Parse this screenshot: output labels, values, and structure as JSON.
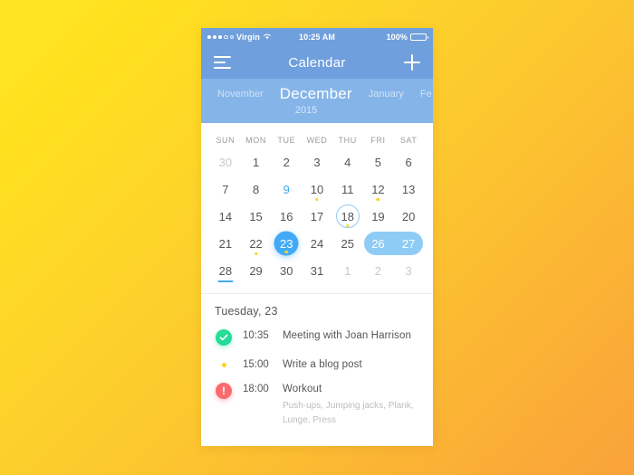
{
  "background": {
    "gradient_from": "#ffe425",
    "gradient_to": "#f9a23a"
  },
  "status_bar": {
    "carrier": "Virgin",
    "signal_filled": 3,
    "signal_empty": 2,
    "wifi_icon": "wifi-icon",
    "time": "10:25 AM",
    "battery_percent": "100%",
    "battery_icon": "battery-icon"
  },
  "nav_bar": {
    "menu_icon": "hamburger-icon",
    "title": "Calendar",
    "add_icon": "plus-icon",
    "background": "#6f9fdc"
  },
  "month_strip": {
    "background": "#84b4e8",
    "months": [
      {
        "label": "November",
        "active": false
      },
      {
        "label": "December",
        "active": true
      },
      {
        "label": "January",
        "active": false
      },
      {
        "label": "Fe",
        "active": false
      }
    ],
    "year": "2015"
  },
  "calendar": {
    "weekdays": [
      "SUN",
      "MON",
      "TUE",
      "WED",
      "THU",
      "FRI",
      "SAT"
    ],
    "accent_blue": "#42aaf5",
    "dot_yellow": "#ffd21f",
    "weeks": [
      [
        {
          "n": "30",
          "muted": true
        },
        {
          "n": "1"
        },
        {
          "n": "2"
        },
        {
          "n": "3"
        },
        {
          "n": "4"
        },
        {
          "n": "5"
        },
        {
          "n": "6"
        }
      ],
      [
        {
          "n": "7"
        },
        {
          "n": "8"
        },
        {
          "n": "9",
          "accent_text": true
        },
        {
          "n": "10",
          "dot": true
        },
        {
          "n": "11"
        },
        {
          "n": "12",
          "dot": true
        },
        {
          "n": "13"
        }
      ],
      [
        {
          "n": "14"
        },
        {
          "n": "15"
        },
        {
          "n": "16"
        },
        {
          "n": "17"
        },
        {
          "n": "18",
          "ring": true,
          "dot": true
        },
        {
          "n": "19"
        },
        {
          "n": "20"
        }
      ],
      [
        {
          "n": "21"
        },
        {
          "n": "22",
          "dot": true
        },
        {
          "n": "23",
          "selected": true,
          "dot": true
        },
        {
          "n": "24"
        },
        {
          "n": "25"
        },
        {
          "n": "26",
          "pill": "start"
        },
        {
          "n": "27",
          "pill": "end"
        }
      ],
      [
        {
          "n": "28",
          "underline": true
        },
        {
          "n": "29"
        },
        {
          "n": "30"
        },
        {
          "n": "31"
        },
        {
          "n": "1",
          "muted": true
        },
        {
          "n": "2",
          "muted": true
        },
        {
          "n": "3",
          "muted": true
        }
      ]
    ]
  },
  "events": {
    "title": "Tuesday, 23",
    "items": [
      {
        "icon": "check-circle-icon",
        "icon_type": "check",
        "time": "10:35",
        "title": "Meeting with Joan Harrison",
        "subtitle": ""
      },
      {
        "icon": "yellow-dot-icon",
        "icon_type": "dot",
        "time": "15:00",
        "title": "Write a blog post",
        "subtitle": ""
      },
      {
        "icon": "alert-circle-icon",
        "icon_type": "alert",
        "icon_glyph": "!",
        "time": "18:00",
        "title": "Workout",
        "subtitle": "Push-ups, Jumping jacks, Plank, Lunge, Press"
      }
    ]
  }
}
